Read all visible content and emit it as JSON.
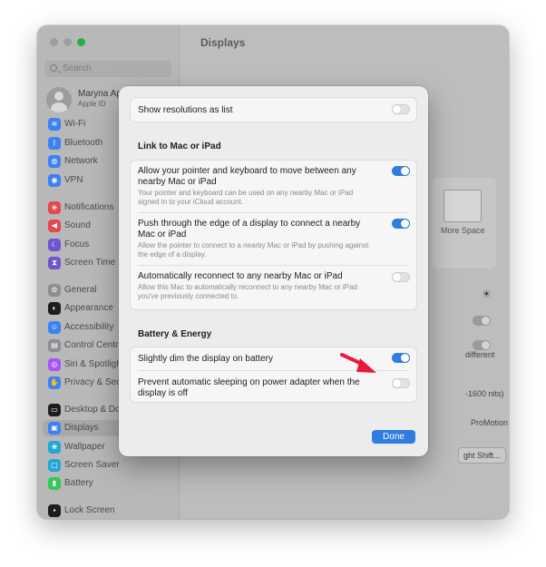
{
  "sidebar": {
    "search_placeholder": "Search",
    "account_name": "Maryna Ap",
    "account_sub": "Apple ID",
    "items": [
      {
        "label": "Wi-Fi",
        "icon": "wifi-icon",
        "color": "#3b82f6"
      },
      {
        "label": "Bluetooth",
        "icon": "bluetooth-icon",
        "color": "#3b82f6"
      },
      {
        "label": "Network",
        "icon": "globe-icon",
        "color": "#3b82f6"
      },
      {
        "label": "VPN",
        "icon": "vpn-icon",
        "color": "#3b82f6"
      },
      {
        "label": "Notifications",
        "icon": "bell-icon",
        "color": "#e5484d"
      },
      {
        "label": "Sound",
        "icon": "speaker-icon",
        "color": "#e5484d"
      },
      {
        "label": "Focus",
        "icon": "moon-icon",
        "color": "#6e56cf"
      },
      {
        "label": "Screen Time",
        "icon": "hourglass-icon",
        "color": "#6e56cf"
      },
      {
        "label": "General",
        "icon": "gear-icon",
        "color": "#8e8e93"
      },
      {
        "label": "Appearance",
        "icon": "appearance-icon",
        "color": "#1d1d1f"
      },
      {
        "label": "Accessibility",
        "icon": "accessibility-icon",
        "color": "#3b82f6"
      },
      {
        "label": "Control Centr",
        "icon": "control-center-icon",
        "color": "#8e8e93"
      },
      {
        "label": "Siri & Spotligh",
        "icon": "siri-icon",
        "color": "#a855f7"
      },
      {
        "label": "Privacy & Sec",
        "icon": "hand-icon",
        "color": "#3b82f6"
      },
      {
        "label": "Desktop & Do",
        "icon": "desktop-icon",
        "color": "#1d1d1f"
      },
      {
        "label": "Displays",
        "icon": "display-icon",
        "color": "#3b82f6"
      },
      {
        "label": "Wallpaper",
        "icon": "wallpaper-icon",
        "color": "#22a7d6"
      },
      {
        "label": "Screen Saver",
        "icon": "screensaver-icon",
        "color": "#22a7d6"
      },
      {
        "label": "Battery",
        "icon": "battery-icon",
        "color": "#34c759"
      },
      {
        "label": "Lock Screen",
        "icon": "lock-icon",
        "color": "#1d1d1f"
      }
    ],
    "selected": "Displays"
  },
  "main": {
    "title": "Displays",
    "more_space": "More Space",
    "different": "different",
    "nits": "-1600 nits)",
    "refresh": "ProMotion",
    "night_shift": "ght Shift...",
    "help": "?"
  },
  "sheet": {
    "show_resolutions": {
      "label": "Show resolutions as list",
      "on": false
    },
    "link_section": "Link to Mac or iPad",
    "link_rows": [
      {
        "title": "Allow your pointer and keyboard to move between any nearby Mac or iPad",
        "desc": "Your pointer and keyboard can be used on any nearby Mac or iPad signed in to your iCloud account.",
        "on": true
      },
      {
        "title": "Push through the edge of a display to connect a nearby Mac or iPad",
        "desc": "Allow the pointer to connect to a nearby Mac or iPad by pushing against the edge of a display.",
        "on": true
      },
      {
        "title": "Automatically reconnect to any nearby Mac or iPad",
        "desc": "Allow this Mac to automatically reconnect to any nearby Mac or iPad you've previously connected to.",
        "on": false
      }
    ],
    "battery_section": "Battery & Energy",
    "battery_rows": [
      {
        "title": "Slightly dim the display on battery",
        "on": true
      },
      {
        "title": "Prevent automatic sleeping on power adapter when the display is off",
        "on": false
      }
    ],
    "done_label": "Done"
  },
  "colors": {
    "accent": "#2f7de1",
    "arrow": "#e8193c"
  }
}
